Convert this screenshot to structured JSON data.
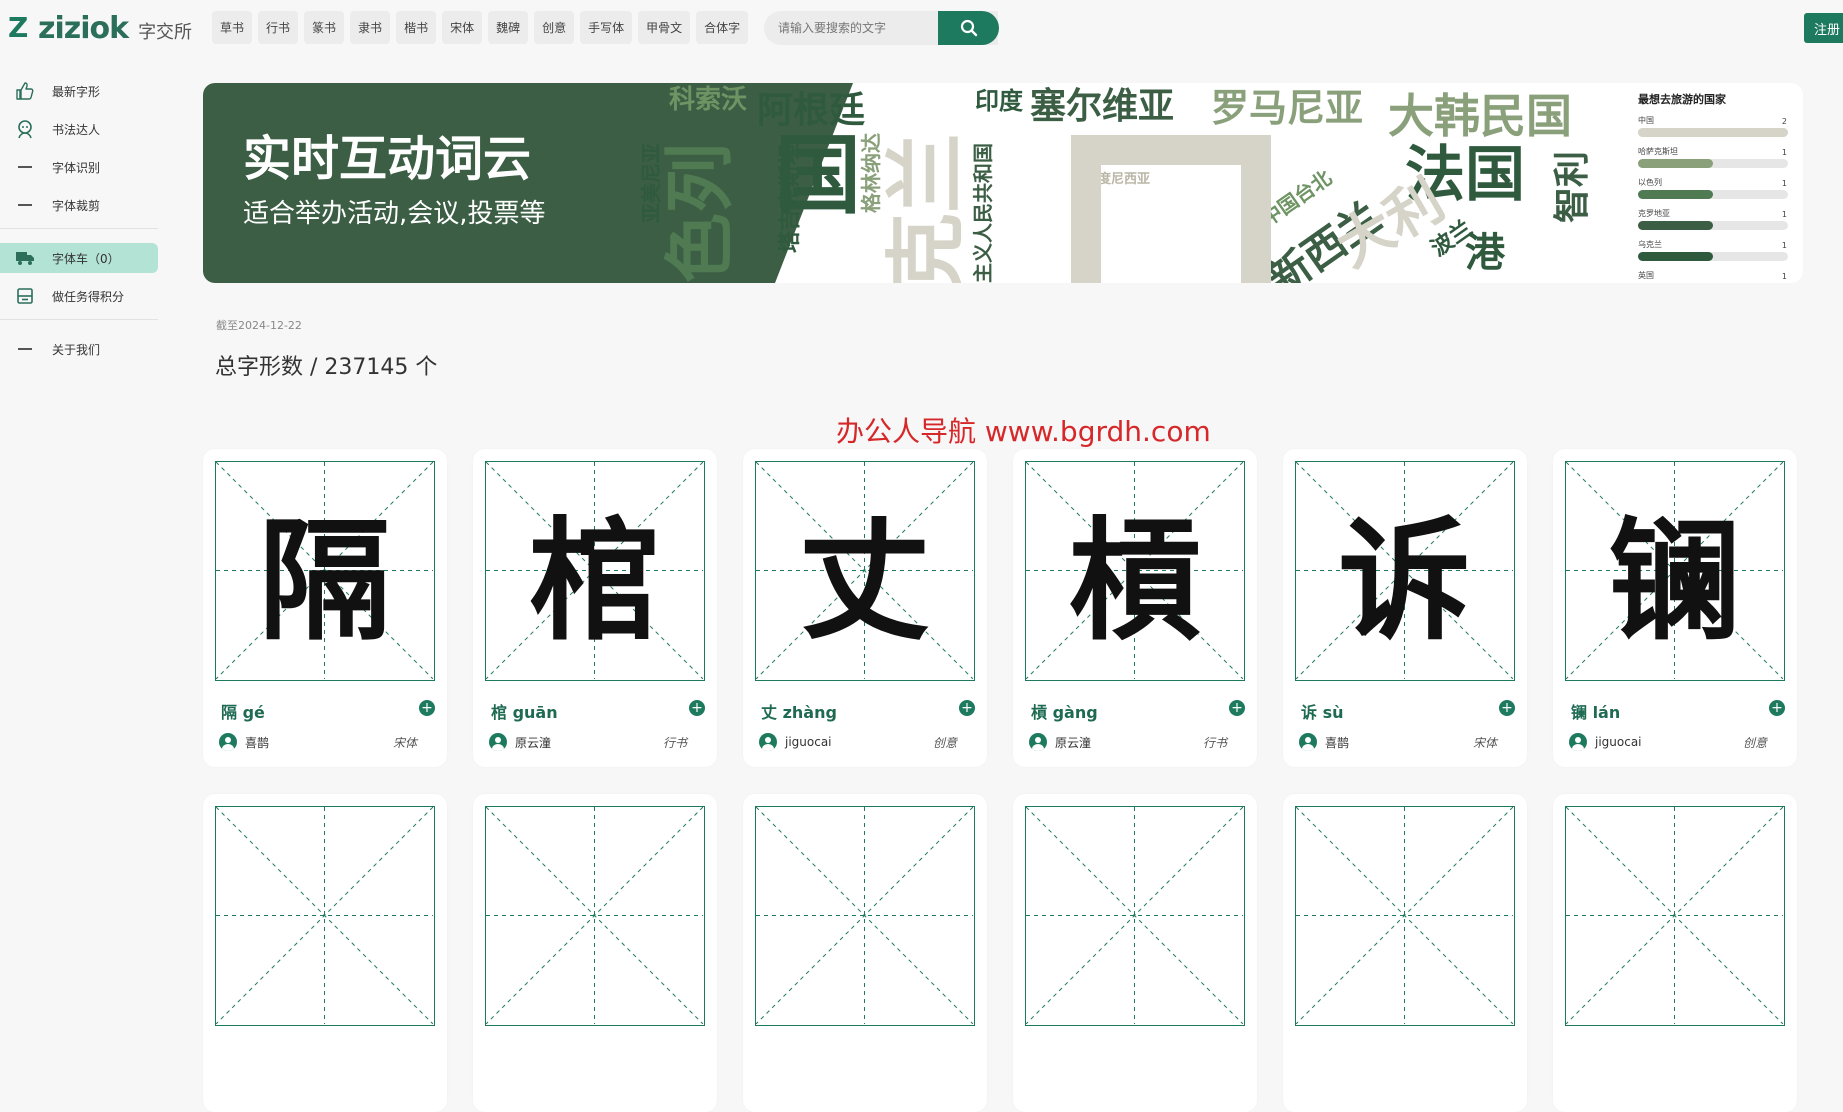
{
  "header": {
    "logo_name": "ziziok",
    "logo_cn": "字交所",
    "categories": [
      "草书",
      "行书",
      "篆书",
      "隶书",
      "楷书",
      "宋体",
      "魏碑",
      "创意",
      "手写体",
      "甲骨文",
      "合体字"
    ],
    "search_placeholder": "请输入要搜索的文字",
    "register_label": "注册"
  },
  "sidebar": {
    "items": [
      {
        "label": "最新字形",
        "icon": "thumbs-up-icon"
      },
      {
        "label": "书法达人",
        "icon": "expert-icon"
      },
      {
        "label": "字体识别",
        "icon": "dash-icon"
      },
      {
        "label": "字体裁剪",
        "icon": "dash-icon"
      },
      {
        "label": "字体车（0）",
        "icon": "truck-icon"
      },
      {
        "label": "做任务得积分",
        "icon": "task-icon"
      },
      {
        "label": "关于我们",
        "icon": "dash-icon"
      }
    ]
  },
  "banner": {
    "title": "实时互动词云",
    "subtitle": "适合举办活动,会议,投票等",
    "cloud_words": [
      "科索沃",
      "阿根廷",
      "印度",
      "塞尔维亚",
      "罗马尼亚",
      "大韩民国",
      "亚美尼亚",
      "色列",
      "塔吉克斯坦",
      "国",
      "格林纳达",
      "克兰",
      "主义人民共和国",
      "印度尼西亚",
      "中国台北",
      "新西兰",
      "法国",
      "智利",
      "波兰",
      "港",
      "大利"
    ],
    "poll": {
      "title": "最想去旅游的国家",
      "rows": [
        {
          "label": "中国",
          "count": "2",
          "fraction": 1.0,
          "color": "#d6d4c8"
        },
        {
          "label": "哈萨克斯坦",
          "count": "1",
          "fraction": 0.5,
          "color": "#8aa07a"
        },
        {
          "label": "以色列",
          "count": "1",
          "fraction": 0.5,
          "color": "#4f7a52"
        },
        {
          "label": "克罗地亚",
          "count": "1",
          "fraction": 0.5,
          "color": "#3b5e44"
        },
        {
          "label": "乌克兰",
          "count": "1",
          "fraction": 0.5,
          "color": "#2f5a3e"
        },
        {
          "label": "英国",
          "count": "1",
          "fraction": 0.5,
          "color": "#d6d4c8"
        }
      ]
    }
  },
  "stats": {
    "as_of": "截至2024-12-22",
    "total": "总字形数 / 237145 个"
  },
  "watermark": "办公人导航 www.bgrdh.com",
  "cards": [
    {
      "glyph": "隔",
      "title": "隔 gé",
      "author": "喜鹊",
      "style": "宋体"
    },
    {
      "glyph": "棺",
      "title": "棺 guān",
      "author": "原云潼",
      "style": "行书"
    },
    {
      "glyph": "丈",
      "title": "丈 zhàng",
      "author": "jiguocai",
      "style": "创意"
    },
    {
      "glyph": "槓",
      "title": "槓 gàng",
      "author": "原云潼",
      "style": "行书"
    },
    {
      "glyph": "诉",
      "title": "诉 sù",
      "author": "喜鹊",
      "style": "宋体"
    },
    {
      "glyph": "镧",
      "title": "镧 lán",
      "author": "jiguocai",
      "style": "创意"
    }
  ]
}
